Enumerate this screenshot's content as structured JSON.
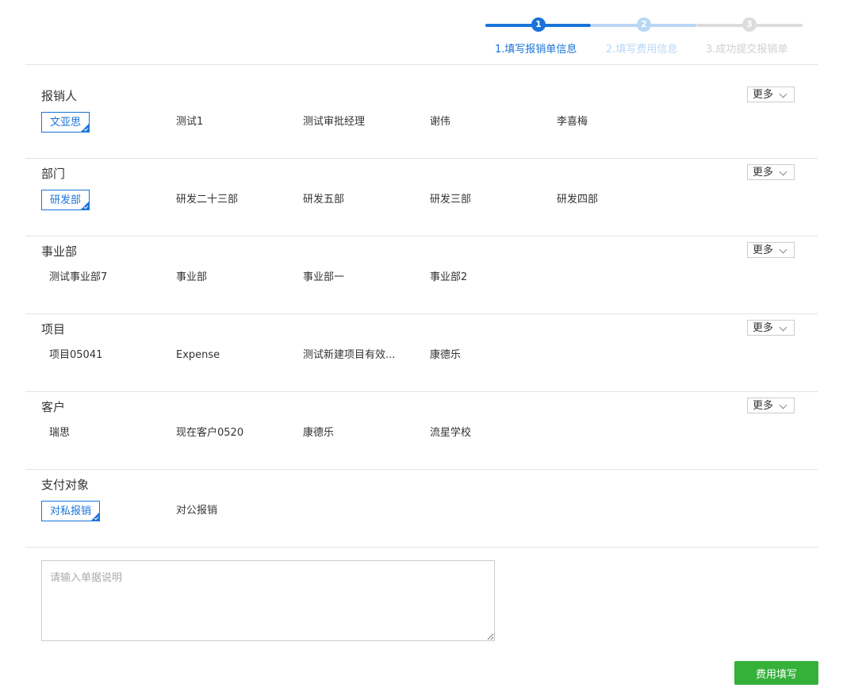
{
  "steps": [
    {
      "num": "1",
      "label": "1.填写报销单信息"
    },
    {
      "num": "2",
      "label": "2.填写费用信息"
    },
    {
      "num": "3",
      "label": "3.成功提交报销单"
    }
  ],
  "more_label": "更多",
  "sections": {
    "reimburser": {
      "title": "报销人",
      "selected": "文亚思",
      "options": [
        "测试1",
        "测试审批经理",
        "谢伟",
        "李喜梅"
      ]
    },
    "department": {
      "title": "部门",
      "selected": "研发部",
      "options": [
        "研发二十三部",
        "研发五部",
        "研发三部",
        "研发四部"
      ]
    },
    "business_unit": {
      "title": "事业部",
      "options": [
        "测试事业部7",
        "事业部",
        "事业部一",
        "事业部2"
      ]
    },
    "project": {
      "title": "项目",
      "options": [
        "项目05041",
        "Expense",
        "测试新建项目有效...",
        "康德乐"
      ]
    },
    "customer": {
      "title": "客户",
      "options": [
        "瑞思",
        "现在客户0520",
        "康德乐",
        "流星学校"
      ]
    },
    "payee": {
      "title": "支付对象",
      "selected": "对私报销",
      "options": [
        "对公报销"
      ]
    }
  },
  "description": {
    "placeholder": "请输入单据说明",
    "value": ""
  },
  "submit_label": "费用填写",
  "colors": {
    "accent": "#1a73d9",
    "accent_light": "#b9d7f5",
    "inactive": "#dcdcdc",
    "submit": "#35b13a"
  }
}
